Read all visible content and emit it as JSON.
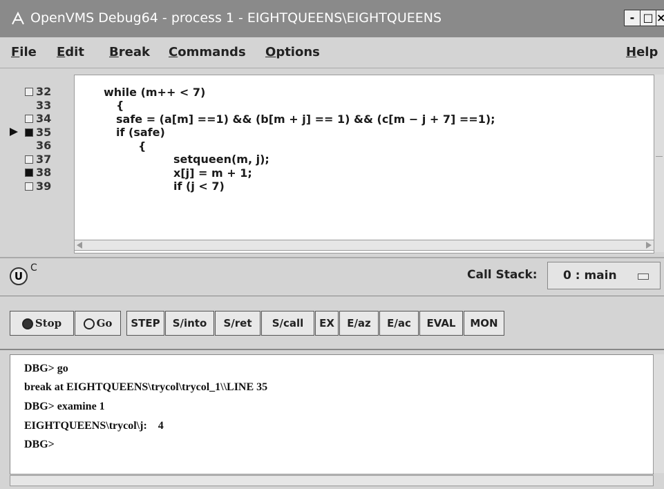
{
  "window": {
    "title": "OpenVMS Debug64 - process 1 - EIGHTQUEENS\\EIGHTQUEENS",
    "minimize": "-",
    "maximize": "□",
    "close": "×"
  },
  "menu": {
    "file": "File",
    "edit": "Edit",
    "break": "Break",
    "commands": "Commands",
    "options": "Options",
    "help": "Help"
  },
  "source": {
    "lines": [
      {
        "num": "32",
        "checkbox": "empty",
        "code": "while (m++ < 7)"
      },
      {
        "num": "33",
        "checkbox": "none",
        "code": "{"
      },
      {
        "num": "34",
        "checkbox": "empty",
        "code": "safe = (a[m] ==1) && (b[m + j] == 1) && (c[m − j + 7] ==1);"
      },
      {
        "num": "35",
        "checkbox": "filled",
        "current": true,
        "code": "if (safe)"
      },
      {
        "num": "36",
        "checkbox": "none",
        "code": "{"
      },
      {
        "num": "37",
        "checkbox": "empty",
        "code": "setqueen(m, j);"
      },
      {
        "num": "38",
        "checkbox": "filled",
        "code": "x[j] = m + 1;"
      },
      {
        "num": "39",
        "checkbox": "empty",
        "code": "if (j < 7)"
      }
    ]
  },
  "status": {
    "badge": "U",
    "language": "C",
    "call_stack_label": "Call Stack:",
    "call_stack_value": "0 : main"
  },
  "toolbar": {
    "stop": "Stop",
    "go": "Go",
    "step": "STEP",
    "s_into": "S/into",
    "s_ret": "S/ret",
    "s_call": "S/call",
    "ex": "EX",
    "e_az": "E/az",
    "e_ac": "E/ac",
    "eval": "EVAL",
    "mon": "MON"
  },
  "console": {
    "lines": [
      "DBG> go",
      "break at EIGHTQUEENS\\trycol\\trycol_1\\\\LINE 35",
      "DBG> examine 1",
      "EIGHTQUEENS\\trycol\\j:    4",
      "DBG>"
    ]
  }
}
